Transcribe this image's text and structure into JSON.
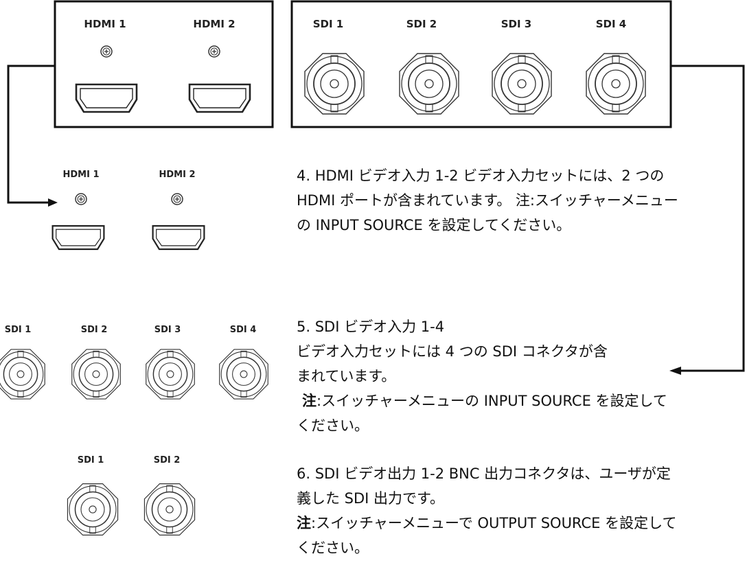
{
  "ports": {
    "hdmi1": "HDMI 1",
    "hdmi2": "HDMI 2",
    "sdi1": "SDI 1",
    "sdi2": "SDI 2",
    "sdi3": "SDI 3",
    "sdi4": "SDI 4"
  },
  "section4": {
    "line1": "4. HDMI ビデオ入力 1-2 ビデオ入力セットには、2 つの",
    "line2": "HDMI ポートが含まれています。 注:スイッチャーメニュー",
    "line3": "の INPUT SOURCE を設定してください。"
  },
  "section5": {
    "line1": "5. SDI ビデオ入力 1-4",
    "line2": "ビデオ入力セットには 4 つの SDI コネクタが含",
    "line3": "まれています。",
    "note_label": "注",
    "note_text": ":スイッチャーメニューの INPUT SOURCE を設定して",
    "line5": "ください。"
  },
  "section6": {
    "line1": "6. SDI ビデオ出力 1-2 BNC 出力コネクタは、ユーザが定",
    "line2": "義した SDI 出力です。",
    "note_label": "注",
    "note_text": ":スイッチャーメニューで OUTPUT SOURCE を設定して",
    "line4": "ください。"
  }
}
